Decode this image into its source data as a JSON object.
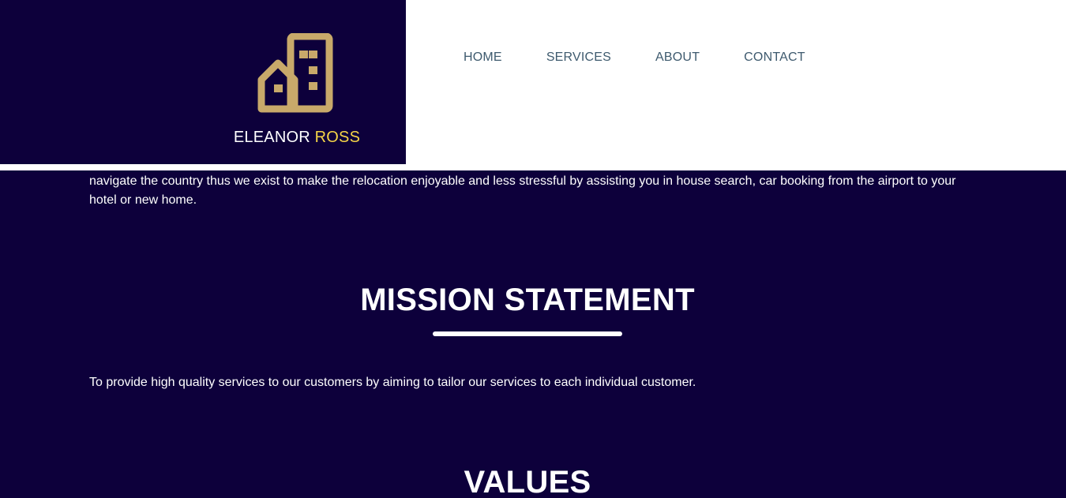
{
  "brand": {
    "logo_icon": "building-house-icon",
    "logo_color": "#c8a96a",
    "name_first": "ELEANOR",
    "name_last": "ROSS",
    "name_accent_color": "#f5d547"
  },
  "nav": {
    "items": [
      {
        "label": "HOME"
      },
      {
        "label": "SERVICES"
      },
      {
        "label": "ABOUT"
      },
      {
        "label": "CONTACT"
      }
    ]
  },
  "content": {
    "intro_text": "navigate the country thus we exist to make the relocation enjoyable and less stressful by assisting you in house search, car booking from the airport to your hotel or new home.",
    "mission": {
      "title": "MISSION STATEMENT",
      "text": "To provide high quality services to our customers by aiming to tailor our services to each individual customer."
    },
    "values": {
      "title": "VALUES"
    }
  },
  "colors": {
    "background": "#0d003b",
    "header_bg": "#ffffff",
    "nav_text": "#3e5a6e",
    "text": "#ffffff"
  }
}
